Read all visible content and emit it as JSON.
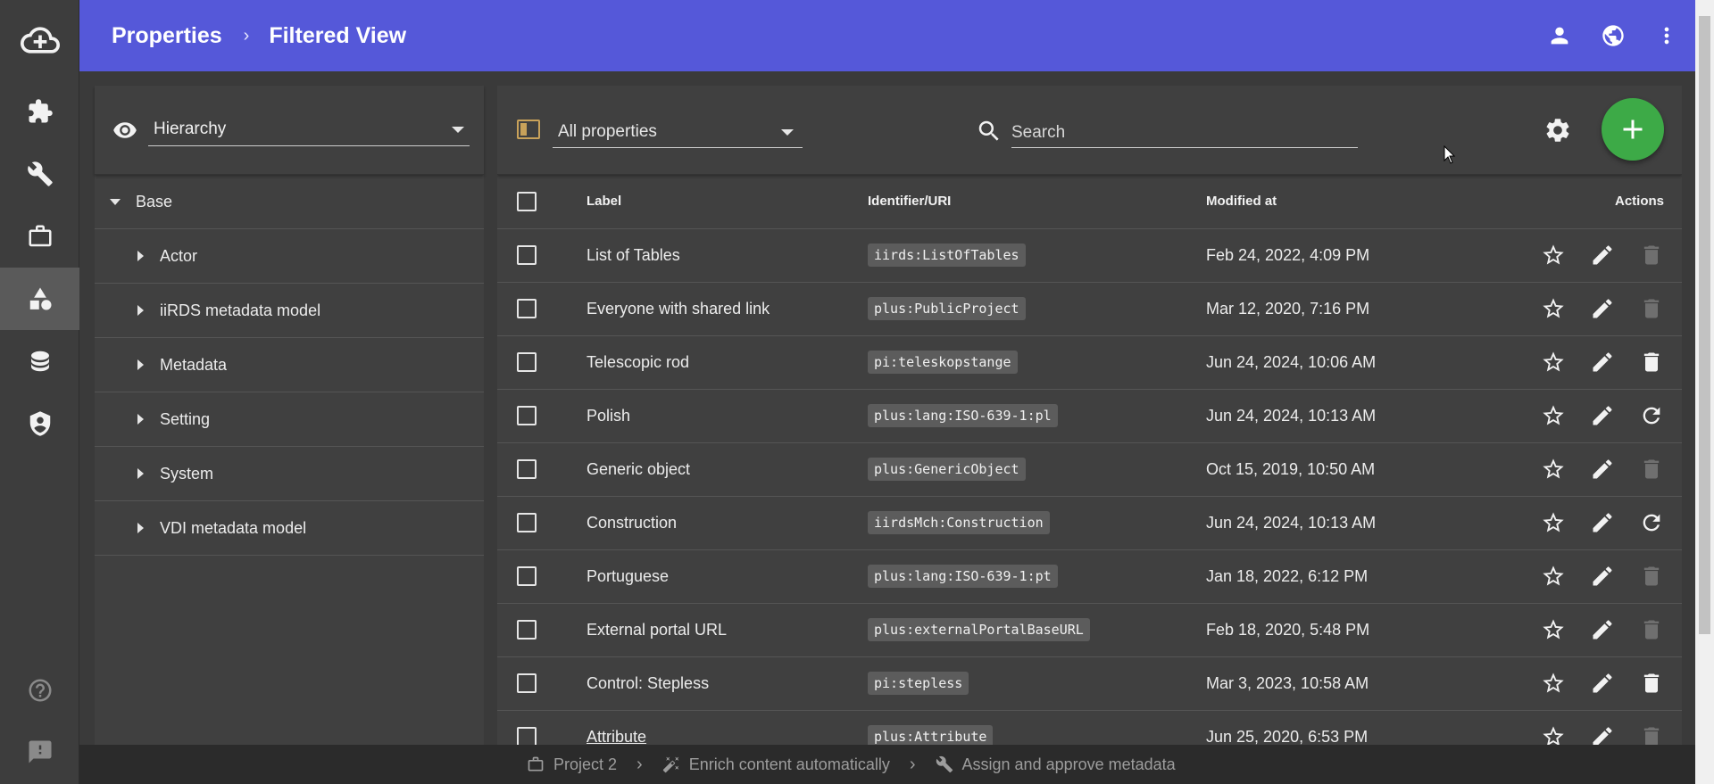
{
  "header": {
    "crumbs": [
      "Properties",
      "Filtered View"
    ],
    "separator": "›"
  },
  "rail": {
    "items": [
      "cloud-upload-icon",
      "puzzle-icon",
      "wrench-icon",
      "briefcase-icon",
      "shapes-icon",
      "database-icon",
      "security-icon",
      "help-icon",
      "feedback-icon"
    ],
    "active": "shapes-icon"
  },
  "left_panel": {
    "hierarchy_label": "Hierarchy",
    "tree": [
      {
        "label": "Base",
        "expanded": true
      },
      {
        "label": "Actor",
        "expanded": false
      },
      {
        "label": "iiRDS metadata model",
        "expanded": false
      },
      {
        "label": "Metadata",
        "expanded": false
      },
      {
        "label": "Setting",
        "expanded": false
      },
      {
        "label": "System",
        "expanded": false
      },
      {
        "label": "VDI metadata model",
        "expanded": false
      }
    ]
  },
  "toolbar": {
    "filter_label": "All properties",
    "search_placeholder": "Search"
  },
  "table": {
    "columns": [
      "Label",
      "Identifier/URI",
      "Modified at",
      "Actions"
    ],
    "rows": [
      {
        "label": "List of Tables",
        "id": "iirds:ListOfTables",
        "modified": "Feb 24, 2022, 4:09 PM",
        "third_action": "delete-disabled"
      },
      {
        "label": "Everyone with shared link",
        "id": "plus:PublicProject",
        "modified": "Mar 12, 2020, 7:16 PM",
        "third_action": "delete-disabled"
      },
      {
        "label": "Telescopic rod",
        "id": "pi:teleskopstange",
        "modified": "Jun 24, 2024, 10:06 AM",
        "third_action": "delete"
      },
      {
        "label": "Polish",
        "id": "plus:lang:ISO-639-1:pl",
        "modified": "Jun 24, 2024, 10:13 AM",
        "third_action": "restore"
      },
      {
        "label": "Generic object",
        "id": "plus:GenericObject",
        "modified": "Oct 15, 2019, 10:50 AM",
        "third_action": "delete-disabled"
      },
      {
        "label": "Construction",
        "id": "iirdsMch:Construction",
        "modified": "Jun 24, 2024, 10:13 AM",
        "third_action": "restore"
      },
      {
        "label": "Portuguese",
        "id": "plus:lang:ISO-639-1:pt",
        "modified": "Jan 18, 2022, 6:12 PM",
        "third_action": "delete-disabled"
      },
      {
        "label": "External portal URL",
        "id": "plus:externalPortalBaseURL",
        "modified": "Feb 18, 2020, 5:48 PM",
        "third_action": "delete-disabled"
      },
      {
        "label": "Control: Stepless",
        "id": "pi:stepless",
        "modified": "Mar 3, 2023, 10:58 AM",
        "third_action": "delete"
      },
      {
        "label": "Attribute",
        "id": "plus:Attribute",
        "modified": "Jun 25, 2020, 6:53 PM",
        "third_action": "delete-disabled"
      }
    ]
  },
  "bottom_bar": {
    "items": [
      "Project 2",
      "Enrich content automatically",
      "Assign and approve metadata"
    ],
    "separator": "›"
  },
  "colors": {
    "header": "#5558d9",
    "fab": "#3daa47",
    "panel": "#404040"
  }
}
